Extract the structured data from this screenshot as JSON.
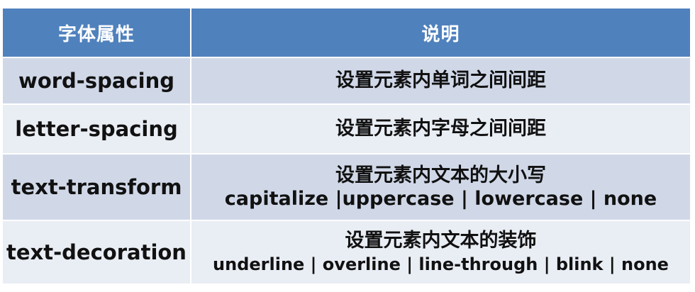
{
  "header": {
    "col_attr": "字体属性",
    "col_desc": "说明"
  },
  "rows": [
    {
      "attr": "word-spacing",
      "desc": "设置元素内单词之间间距",
      "values": ""
    },
    {
      "attr": "letter-spacing",
      "desc": "设置元素内字母之间间距",
      "values": ""
    },
    {
      "attr": "text-transform",
      "desc": "设置元素内文本的大小写",
      "values": "capitalize |uppercase | lowercase | none"
    },
    {
      "attr": "text-decoration",
      "desc": "设置元素内文本的装饰",
      "values": "underline | overline | line-through | blink | none"
    }
  ],
  "colors": {
    "header_bg": "#4f81bd",
    "row_dark": "#d0d8e8",
    "row_light": "#e9edf4"
  }
}
